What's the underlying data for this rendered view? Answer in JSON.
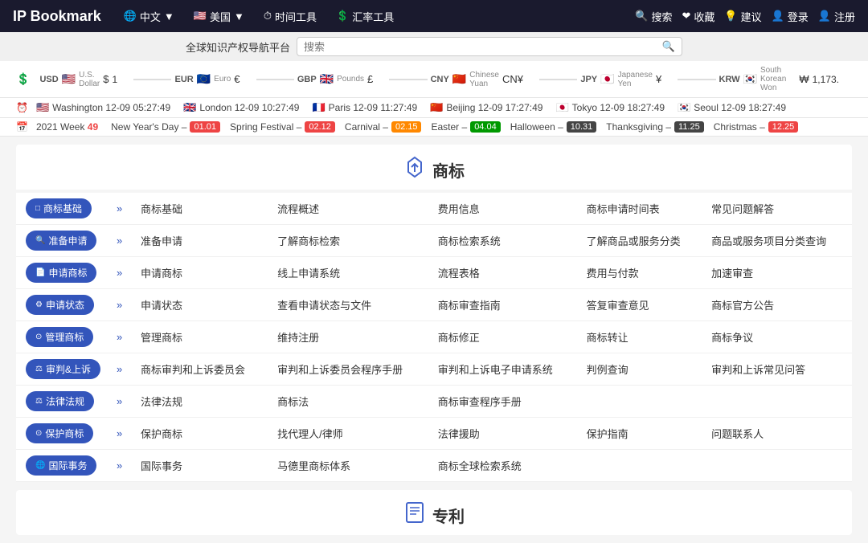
{
  "logo": "IP Bookmark",
  "platform": "全球知识产权导航平台",
  "nav": {
    "lang_cn": "中文",
    "lang_us": "美国",
    "time_tool": "时间工具",
    "exchange_tool": "汇率工具",
    "search": "搜索",
    "collect": "收藏",
    "suggest": "建议",
    "login": "登录",
    "register": "注册"
  },
  "search_placeholder": "搜索",
  "currencies": [
    {
      "name": "USD",
      "sub": "U.S. Dollar",
      "flag": "🇺🇸",
      "symbol": "$",
      "value": "1"
    },
    {
      "name": "EUR",
      "sub": "Euro",
      "flag": "🇪🇺",
      "symbol": "€"
    },
    {
      "name": "GBP",
      "sub": "Pounds",
      "flag": "🇬🇧",
      "symbol": "£"
    },
    {
      "name": "CNY",
      "sub": "Chinese Yuan",
      "flag": "🇨🇳",
      "symbol": "CN¥"
    },
    {
      "name": "JPY",
      "sub": "Japanese Yen",
      "flag": "🇯🇵",
      "symbol": "¥"
    },
    {
      "name": "KRW",
      "sub": "South Korean Won",
      "flag": "🇰🇷",
      "symbol": "₩",
      "value": "1,173."
    }
  ],
  "times": [
    {
      "city": "Washington",
      "flag": "🇺🇸",
      "time": "12-09 05:27:49"
    },
    {
      "city": "London",
      "flag": "🇬🇧",
      "time": "12-09 10:27:49"
    },
    {
      "city": "Paris",
      "flag": "🇫🇷",
      "time": "12-09 11:27:49"
    },
    {
      "city": "Beijing",
      "flag": "🇨🇳",
      "time": "12-09 17:27:49"
    },
    {
      "city": "Tokyo",
      "flag": "🇯🇵",
      "time": "12-09 18:27:49"
    },
    {
      "city": "Seoul",
      "flag": "🇰🇷",
      "time": "12-09 18:27:49"
    }
  ],
  "calendar": {
    "week_label": "2021 Week",
    "week_num": "49",
    "holidays": [
      {
        "name": "New Year's Day",
        "date": "01.01",
        "color": "red"
      },
      {
        "name": "Spring Festival",
        "date": "02.12",
        "color": "red"
      },
      {
        "name": "Carnival",
        "date": "02.15",
        "color": "orange"
      },
      {
        "name": "Easter",
        "date": "04.04",
        "color": "green"
      },
      {
        "name": "Halloween",
        "date": "10.31",
        "color": "dark"
      },
      {
        "name": "Thanksgiving",
        "date": "11.25",
        "color": "dark"
      },
      {
        "name": "Christmas",
        "date": "12.25",
        "color": "red"
      }
    ]
  },
  "trademark_section": {
    "title": "商标",
    "icon": "🏷",
    "rows": [
      {
        "cat": "商标基础",
        "cat_icon": "□",
        "links": [
          "商标基础",
          "流程概述",
          "费用信息",
          "商标申请时间表",
          "常见问题解答"
        ]
      },
      {
        "cat": "准备申请",
        "cat_icon": "🔍",
        "links": [
          "准备申请",
          "了解商标检索",
          "商标检索系统",
          "了解商品或服务分类",
          "商品或服务项目分类查询"
        ]
      },
      {
        "cat": "申请商标",
        "cat_icon": "📄",
        "links": [
          "申请商标",
          "线上申请系统",
          "流程表格",
          "费用与付款",
          "加速审查"
        ]
      },
      {
        "cat": "申请状态",
        "cat_icon": "⚙",
        "links": [
          "申请状态",
          "查看申请状态与文件",
          "商标审查指南",
          "答复审查意见",
          "商标官方公告"
        ]
      },
      {
        "cat": "管理商标",
        "cat_icon": "⊙",
        "links": [
          "管理商标",
          "维持注册",
          "商标修正",
          "商标转让",
          "商标争议"
        ]
      },
      {
        "cat": "审判&上诉",
        "cat_icon": "⚖",
        "links": [
          "商标审判和上诉委员会",
          "审判和上诉委员会程序手册",
          "审判和上诉电子申请系统",
          "判例查询",
          "审判和上诉常见问答"
        ]
      },
      {
        "cat": "法律法规",
        "cat_icon": "⚖",
        "links": [
          "法律法规",
          "商标法",
          "商标审查程序手册",
          "",
          ""
        ]
      },
      {
        "cat": "保护商标",
        "cat_icon": "⊙",
        "links": [
          "保护商标",
          "找代理人/律师",
          "法律援助",
          "保护指南",
          "问题联系人"
        ]
      },
      {
        "cat": "国际事务",
        "cat_icon": "🌐",
        "links": [
          "国际事务",
          "马德里商标体系",
          "商标全球检索系统",
          "",
          ""
        ]
      }
    ]
  },
  "patent_section": {
    "title": "专利",
    "icon": "🏢"
  }
}
